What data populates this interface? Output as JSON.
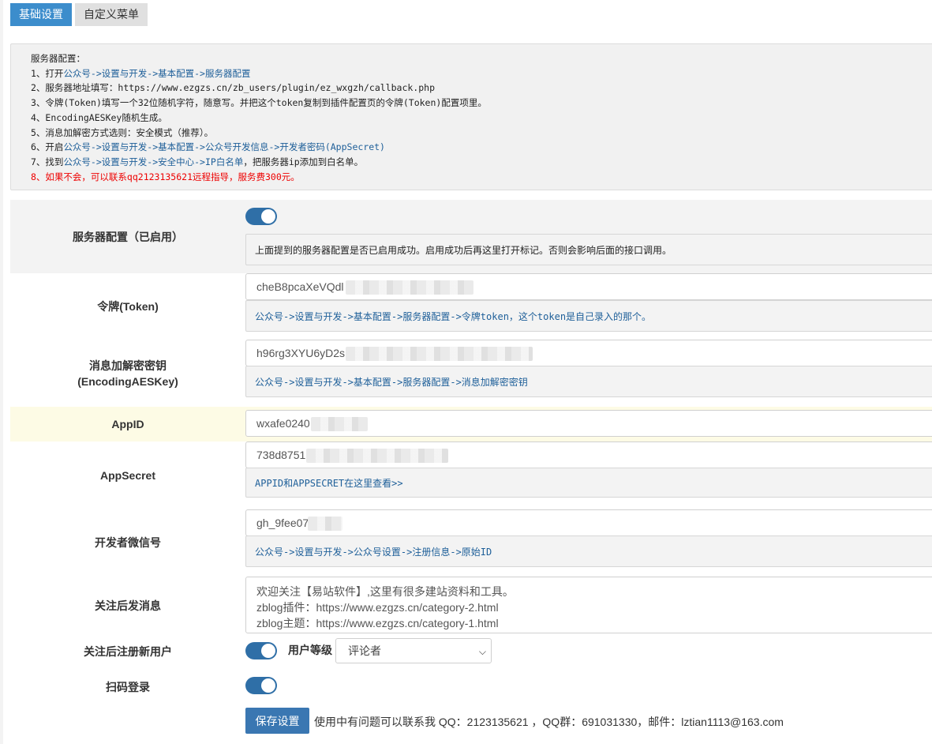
{
  "tabs": [
    {
      "label": "基础设置",
      "active": true
    },
    {
      "label": "自定义菜单",
      "active": false
    }
  ],
  "info": {
    "title": "服务器配置：",
    "lines": [
      {
        "prefix": "1、打开",
        "blue": "公众号->设置与开发->基本配置->服务器配置",
        "suffix": ""
      },
      {
        "prefix": "2、服务器地址填写：https://www.ezgzs.cn/zb_users/plugin/ez_wxgzh/callback.php",
        "blue": "",
        "suffix": ""
      },
      {
        "prefix": "3、令牌(Token)填写一个32位随机字符，随意写。并把这个token复制到插件配置页的令牌(Token)配置项里。",
        "blue": "",
        "suffix": ""
      },
      {
        "prefix": "4、EncodingAESKey随机生成。",
        "blue": "",
        "suffix": ""
      },
      {
        "prefix": "5、消息加解密方式选则：安全模式（推荐）。",
        "blue": "",
        "suffix": ""
      },
      {
        "prefix": "6、开启",
        "blue": "公众号->设置与开发->基本配置->公众号开发信息->开发者密码(AppSecret)",
        "suffix": ""
      },
      {
        "prefix": "7、找到",
        "blue": "公众号->设置与开发->安全中心->IP白名单",
        "suffix": "，把服务器ip添加到白名单。"
      }
    ],
    "warning": "8、如果不会，可以联系qq2123135621远程指导，服务费300元。"
  },
  "settings": {
    "server": {
      "label": "服务器配置（已启用）",
      "enabled": true,
      "hint": "上面提到的服务器配置是否已启用成功。启用成功后再这里打开标记。否则会影响后面的接口调用。"
    },
    "token": {
      "label": "令牌(Token)",
      "value": "cheB8pcaXeVQdl",
      "hint": "公众号->设置与开发->基本配置->服务器配置->令牌token，这个token是自己录入的那个。"
    },
    "aeskey": {
      "label_line1": "消息加解密密钥",
      "label_line2": "(EncodingAESKey)",
      "value": "h96rg3XYU6yD2s",
      "hint": "公众号->设置与开发->基本配置->服务器配置->消息加解密密钥"
    },
    "appid": {
      "label": "AppID",
      "value": "wxafe0240"
    },
    "appsecret": {
      "label": "AppSecret",
      "value": "738d8751",
      "hint": "APPID和APPSECRET在这里查看>>"
    },
    "wechat_id": {
      "label": "开发者微信号",
      "value": "gh_9fee07",
      "hint": "公众号->设置与开发->公众号设置->注册信息->原始ID"
    },
    "welcome": {
      "label": "关注后发消息",
      "lines": [
        "欢迎关注【易站软件】,这里有很多建站资料和工具。",
        "zblog插件：https://www.ezgzs.cn/category-2.html",
        "zblog主题：https://www.ezgzs.cn/category-1.html"
      ]
    },
    "register": {
      "label": "关注后注册新用户",
      "enabled": true,
      "level_label": "用户等级",
      "level_value": "评论者"
    },
    "qrlogin": {
      "label": "扫码登录",
      "enabled": true
    }
  },
  "footer": {
    "save_label": "保存设置",
    "contact": "使用中有问题可以联系我 QQ：2123135621 ，QQ群：691031330，邮件：lztian1113@163.com"
  },
  "colors": {
    "primary": "#3c8dcc",
    "toggle_on": "#2f6fa7",
    "link": "#1e5f99",
    "warning": "#ee0000"
  }
}
